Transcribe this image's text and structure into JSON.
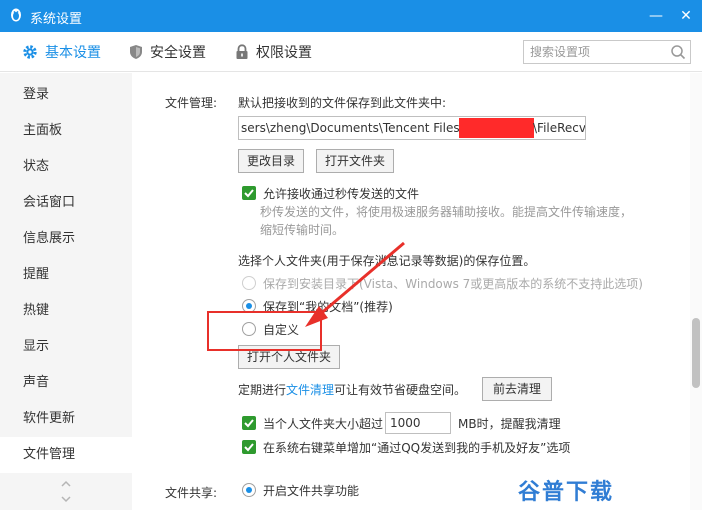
{
  "window": {
    "title": "系统设置",
    "minimize": "—",
    "close": "✕"
  },
  "tabs": [
    {
      "label": "基本设置",
      "icon": "gear-icon",
      "active": true
    },
    {
      "label": "安全设置",
      "icon": "shield-icon"
    },
    {
      "label": "权限设置",
      "icon": "lock-icon"
    }
  ],
  "search": {
    "placeholder": "搜索设置项",
    "icon": "search-icon"
  },
  "sidebar": {
    "items": [
      "登录",
      "主面板",
      "状态",
      "会话窗口",
      "信息展示",
      "提醒",
      "热键",
      "显示",
      "声音",
      "软件更新",
      "文件管理"
    ],
    "active_index": 10
  },
  "file_management": {
    "section_label": "文件管理:",
    "save_to_label": "默认把接收到的文件保存到此文件夹中:",
    "path_prefix": "sers\\zheng\\Documents\\Tencent Files\\",
    "path_suffix": "\\FileRecv\\",
    "change_dir": "更改目录",
    "open_folder": "打开文件夹",
    "allow_instant": "允许接收通过秒传发送的文件",
    "instant_hint": "秒传发送的文件，将使用极速服务器辅助接收。能提高文件传输速度，缩短传输时间。",
    "personal_folder_label": "选择个人文件夹(用于保存消息记录等数据)的保存位置。",
    "opt_install": "保存到安装目录下(Vista、Windows 7或更高版本的系统不支持此选项)",
    "opt_mydocs": "保存到“我的文档”(推荐)",
    "opt_custom": "自定义",
    "open_personal": "打开个人文件夹",
    "cleanup_prefix": "定期进行",
    "cleanup_link": "文件清理",
    "cleanup_suffix": "可让有效节省硬盘空间。",
    "go_cleanup": "前去清理",
    "size_prefix": "当个人文件夹大小超过",
    "size_value": "1000",
    "size_suffix": "MB时，提醒我清理",
    "context_menu": "在系统右键菜单增加“通过QQ发送到我的手机及好友”选项"
  },
  "file_sharing": {
    "section_label": "文件共享:",
    "enable": "开启文件共享功能"
  },
  "watermark": "谷普下载",
  "colors": {
    "accent": "#1a8fe6",
    "check": "#2e9a2e",
    "annotation": "#e8302a",
    "redaction": "#ff2a2a"
  }
}
